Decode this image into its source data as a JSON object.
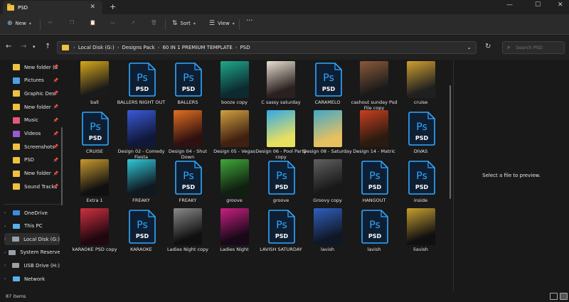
{
  "window": {
    "tab_title": "PSD",
    "new_tab": "+",
    "close_tab": "✕",
    "minimize": "—",
    "maximize": "☐",
    "close": "✕"
  },
  "toolbar": {
    "new_label": "New",
    "sort_label": "Sort",
    "view_label": "View",
    "more_label": "···"
  },
  "address": {
    "crumbs": [
      "Local Disk (G:)",
      "Designs Pack",
      "60 IN 1 PREMIUM TEMPLATE",
      "PSD"
    ],
    "search_placeholder": "Search PSD"
  },
  "sidebar": {
    "quick_access": [
      {
        "label": "New folder (3",
        "color": "#f0c040"
      },
      {
        "label": "Pictures",
        "color": "#4aa3e0"
      },
      {
        "label": "Graphic Desi",
        "color": "#f0c040"
      },
      {
        "label": "New folder",
        "color": "#f0c040"
      },
      {
        "label": "Music",
        "color": "#e05a7a"
      },
      {
        "label": "Videos",
        "color": "#9a5ad0"
      },
      {
        "label": "Screenshots",
        "color": "#f0c040"
      },
      {
        "label": "PSD",
        "color": "#f0c040"
      },
      {
        "label": "New folder",
        "color": "#f0c040"
      },
      {
        "label": "Sound Tracks",
        "color": "#f0c040"
      }
    ],
    "locations": [
      {
        "label": "OneDrive",
        "color": "#3a8ee6"
      },
      {
        "label": "This PC",
        "color": "#5ab0e8"
      },
      {
        "label": "Local Disk (G:)",
        "color": "#9aa0a8"
      },
      {
        "label": "System Reserved",
        "color": "#9aa0a8"
      },
      {
        "label": "USB Drive (H:)",
        "color": "#9aa0a8"
      },
      {
        "label": "Network",
        "color": "#5ab0e8"
      }
    ]
  },
  "files": [
    {
      "name": "ball",
      "type": "thumb",
      "c1": "#d6a81a",
      "c2": "#1a1a1a"
    },
    {
      "name": "BALLERS NIGHT OUT",
      "type": "psd"
    },
    {
      "name": "BALLERS",
      "type": "psd"
    },
    {
      "name": "booze copy",
      "type": "thumb",
      "c1": "#1fa88a",
      "c2": "#0c2a30"
    },
    {
      "name": "C sassy saturday",
      "type": "thumb",
      "c1": "#e8e0d0",
      "c2": "#2a2020"
    },
    {
      "name": "CARAMELO",
      "type": "psd"
    },
    {
      "name": "cashout sunday Psd File copy",
      "type": "thumb",
      "c1": "#8a5a3a",
      "c2": "#1a1a1a"
    },
    {
      "name": "cruise",
      "type": "thumb",
      "c1": "#d0a030",
      "c2": "#202020"
    },
    {
      "name": "CRUISE",
      "type": "psd"
    },
    {
      "name": "Design 02 - Comedy Fiesta",
      "type": "thumb",
      "c1": "#3a5ad8",
      "c2": "#10183a"
    },
    {
      "name": "Design 04 - Shut Down",
      "type": "thumb",
      "c1": "#e07020",
      "c2": "#301010"
    },
    {
      "name": "Design 05 - Vegas",
      "type": "thumb",
      "c1": "#d0a040",
      "c2": "#402010"
    },
    {
      "name": "Design 06 - Pool Party copy",
      "type": "thumb",
      "c1": "#30a8e8",
      "c2": "#e8e060"
    },
    {
      "name": "Design 08 - Saturday",
      "type": "thumb",
      "c1": "#40a8c8",
      "c2": "#e8c060"
    },
    {
      "name": "Design 14 - Matric",
      "type": "thumb",
      "c1": "#c84020",
      "c2": "#2a1a10"
    },
    {
      "name": "DIVAS",
      "type": "psd"
    },
    {
      "name": "Extra 1",
      "type": "thumb",
      "c1": "#c89a30",
      "c2": "#101010"
    },
    {
      "name": "FREAKY",
      "type": "thumb",
      "c1": "#30c8d8",
      "c2": "#101820"
    },
    {
      "name": "FREAKY",
      "type": "psd"
    },
    {
      "name": "groove",
      "type": "thumb",
      "c1": "#40a838",
      "c2": "#102010"
    },
    {
      "name": "groove",
      "type": "psd"
    },
    {
      "name": "Groovy copy",
      "type": "thumb",
      "c1": "#606060",
      "c2": "#181818"
    },
    {
      "name": "HANGOUT",
      "type": "psd"
    },
    {
      "name": "inside",
      "type": "psd"
    },
    {
      "name": "kARAOKE PSD copy",
      "type": "thumb",
      "c1": "#d03040",
      "c2": "#200810"
    },
    {
      "name": "KARAOKE",
      "type": "psd"
    },
    {
      "name": "Ladies Night copy",
      "type": "thumb",
      "c1": "#8a8a8a",
      "c2": "#101010"
    },
    {
      "name": "Ladies Night",
      "type": "thumb",
      "c1": "#c82080",
      "c2": "#180818"
    },
    {
      "name": "LAVISH SATURDAY",
      "type": "psd"
    },
    {
      "name": "lavish",
      "type": "thumb",
      "c1": "#3060c0",
      "c2": "#101828"
    },
    {
      "name": "lavish",
      "type": "psd"
    },
    {
      "name": "liavish",
      "type": "thumb",
      "c1": "#c8a030",
      "c2": "#101010"
    }
  ],
  "preview": {
    "message": "Select a file to preview."
  },
  "status": {
    "item_count": "87 items"
  }
}
